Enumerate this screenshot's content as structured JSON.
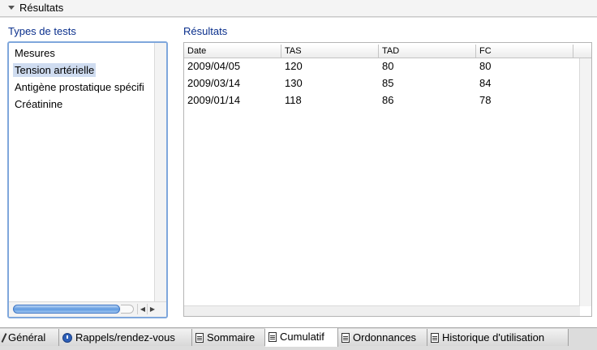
{
  "section": {
    "title": "Résultats"
  },
  "types": {
    "label": "Types de tests",
    "items": [
      {
        "label": "Mesures",
        "selected": false
      },
      {
        "label": "Tension artérielle",
        "selected": true
      },
      {
        "label": "Antigène prostatique spécifi",
        "selected": false
      },
      {
        "label": "Créatinine",
        "selected": false
      }
    ]
  },
  "results": {
    "label": "Résultats",
    "columns": [
      "Date",
      "TAS",
      "TAD",
      "FC"
    ],
    "rows": [
      [
        "2009/04/05",
        "120",
        "80",
        "80"
      ],
      [
        "2009/03/14",
        "130",
        "85",
        "84"
      ],
      [
        "2009/01/14",
        "118",
        "86",
        "78"
      ]
    ]
  },
  "tabs": [
    {
      "label": "Général",
      "icon": "pen-icon",
      "active": false
    },
    {
      "label": "Rappels/rendez-vous",
      "icon": "clock-icon",
      "active": false
    },
    {
      "label": "Sommaire",
      "icon": "document-icon",
      "active": false
    },
    {
      "label": "Cumulatif",
      "icon": "document-icon",
      "active": true
    },
    {
      "label": "Ordonnances",
      "icon": "document-icon",
      "active": false
    },
    {
      "label": "Historique d'utilisation",
      "icon": "document-icon",
      "active": false
    }
  ],
  "colors": {
    "label_blue": "#0a2f8c",
    "selection": "#cfdcf0",
    "focus_border": "#7fa7dc"
  }
}
